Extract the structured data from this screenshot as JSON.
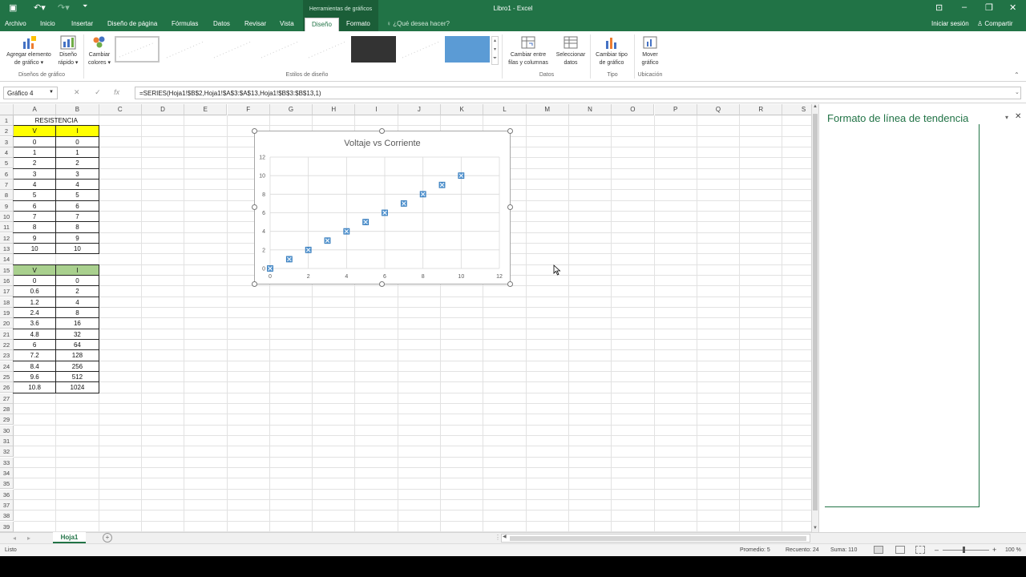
{
  "titlebar": {
    "context_label": "Herramientas de gráficos",
    "document_title": "Libro1 - Excel"
  },
  "tabs": {
    "file": "Archivo",
    "home": "Inicio",
    "insert": "Insertar",
    "page_layout": "Diseño de página",
    "formulas": "Fórmulas",
    "data": "Datos",
    "review": "Revisar",
    "view": "Vista",
    "design": "Diseño",
    "format": "Formato",
    "tell_me": "¿Qué desea hacer?",
    "sign_in": "Iniciar sesión",
    "share": "Compartir"
  },
  "ribbon": {
    "add_chart_element": [
      "Agregar elemento",
      "de gráfico ▾"
    ],
    "quick_layout": [
      "Diseño",
      "rápido ▾"
    ],
    "change_colors": [
      "Cambiar",
      "colores ▾"
    ],
    "group_layouts": "Diseños de gráfico",
    "group_styles": "Estilos de diseño",
    "switch_row_col": [
      "Cambiar entre",
      "filas y columnas"
    ],
    "select_data": [
      "Seleccionar",
      "datos"
    ],
    "group_data": "Datos",
    "change_type": [
      "Cambiar tipo",
      "de gráfico"
    ],
    "group_type": "Tipo",
    "move_chart": [
      "Mover",
      "gráfico"
    ],
    "group_location": "Ubicación"
  },
  "formula_bar": {
    "name_box": "Gráfico 4",
    "fx": "fx",
    "formula": "=SERIES(Hoja1!$B$2,Hoja1!$A$3:$A$13,Hoja1!$B$3:$B$13,1)"
  },
  "sheet": {
    "columns": [
      "A",
      "B",
      "C",
      "D",
      "E",
      "F",
      "G",
      "H",
      "I",
      "J",
      "K",
      "L",
      "M",
      "N",
      "O",
      "P",
      "Q",
      "R",
      "S"
    ],
    "title_cell": "RESISTENCIA",
    "table1_header": [
      "V",
      "I"
    ],
    "table1_rows": [
      [
        "0",
        "0"
      ],
      [
        "1",
        "1"
      ],
      [
        "2",
        "2"
      ],
      [
        "3",
        "3"
      ],
      [
        "4",
        "4"
      ],
      [
        "5",
        "5"
      ],
      [
        "6",
        "6"
      ],
      [
        "7",
        "7"
      ],
      [
        "8",
        "8"
      ],
      [
        "9",
        "9"
      ],
      [
        "10",
        "10"
      ]
    ],
    "table2_header": [
      "V",
      "I"
    ],
    "table2_rows": [
      [
        "0",
        "0"
      ],
      [
        "0.6",
        "2"
      ],
      [
        "1.2",
        "4"
      ],
      [
        "2.4",
        "8"
      ],
      [
        "3.6",
        "16"
      ],
      [
        "4.8",
        "32"
      ],
      [
        "6",
        "64"
      ],
      [
        "7.2",
        "128"
      ],
      [
        "8.4",
        "256"
      ],
      [
        "9.6",
        "512"
      ],
      [
        "10.8",
        "1024"
      ]
    ],
    "colors": {
      "header_yellow": "#ffff00",
      "header_green": "#a9d08e"
    }
  },
  "chart_data": {
    "type": "scatter",
    "title": "Voltaje vs Corriente",
    "x": [
      0,
      1,
      2,
      3,
      4,
      5,
      6,
      7,
      8,
      9,
      10
    ],
    "series": [
      {
        "values": [
          0,
          1,
          2,
          3,
          4,
          5,
          6,
          7,
          8,
          9,
          10
        ],
        "color": "#5b9bd5"
      }
    ],
    "xlim": [
      0,
      12
    ],
    "ylim": [
      0,
      12
    ],
    "xticks": [
      "0",
      "2",
      "4",
      "6",
      "8",
      "10",
      "12"
    ],
    "yticks": [
      "0",
      "2",
      "4",
      "6",
      "8",
      "10",
      "12"
    ],
    "grid": true
  },
  "task_pane": {
    "title": "Formato de línea de tendencia"
  },
  "sheet_tabs": {
    "active": "Hoja1"
  },
  "status": {
    "ready": "Listo",
    "average": "Promedio: 5",
    "count": "Recuento: 24",
    "sum": "Suma: 110",
    "zoom": "100 %"
  }
}
